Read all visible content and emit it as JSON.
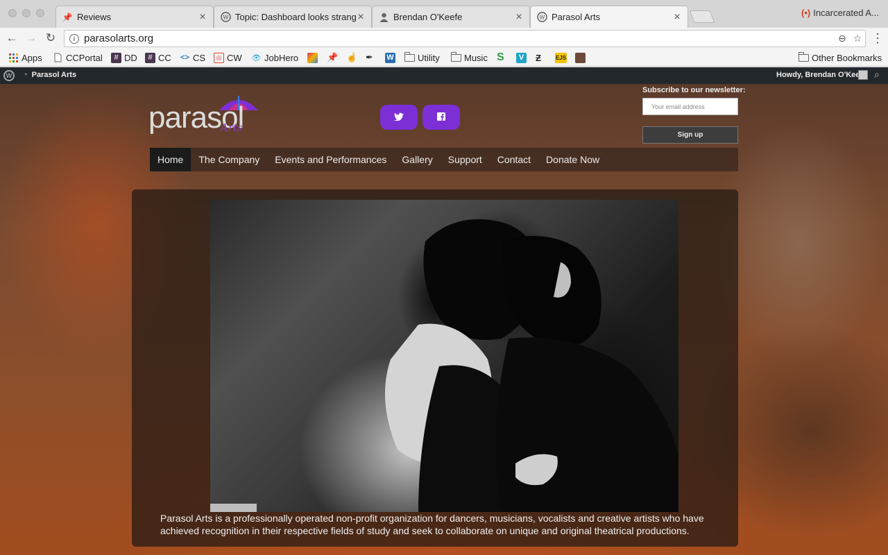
{
  "browser": {
    "tabs": [
      {
        "title": "Reviews",
        "icon": "pin-icon"
      },
      {
        "title": "Topic: Dashboard looks strang",
        "icon": "wordpress-icon"
      },
      {
        "title": "Brendan O'Keefe",
        "icon": "person-icon"
      },
      {
        "title": "Parasol Arts",
        "icon": "wordpress-icon"
      }
    ],
    "tab_right_text": "Incarcerated A...",
    "url": "parasolarts.org",
    "bookmarks": [
      {
        "label": "Apps",
        "icon": "apps-grid-icon"
      },
      {
        "label": "CCPortal",
        "icon": "page-icon"
      },
      {
        "label": "DD",
        "icon": "hash-icon"
      },
      {
        "label": "CC",
        "icon": "hash-icon"
      },
      {
        "label": "CS",
        "icon": "code-icon"
      },
      {
        "label": "CW",
        "icon": "cw-icon"
      },
      {
        "label": "JobHero",
        "icon": "eye-icon"
      },
      {
        "label": "Utility",
        "icon": "folder-icon"
      },
      {
        "label": "Music",
        "icon": "folder-icon"
      },
      {
        "label": "Other Bookmarks",
        "icon": "folder-icon"
      }
    ]
  },
  "adminbar": {
    "site_name": "Parasol Arts",
    "howdy": "Howdy, Brendan O'Keefe"
  },
  "site": {
    "logo_word": "parasol",
    "logo_sub": "Arts",
    "newsletter": {
      "label": "Subscribe to our newsletter:",
      "placeholder": "Your email address",
      "button": "Sign up"
    },
    "nav": [
      "Home",
      "The Company",
      "Events and Performances",
      "Gallery",
      "Support",
      "Contact",
      "Donate Now"
    ],
    "caption": "Parasol Arts is a professionally operated non-profit organization for dancers, musicians, vocalists and creative artists who have achieved recognition in their respective fields of study and seek to collaborate on unique and original theatrical productions."
  },
  "colors": {
    "social_button": "#7d2fd6",
    "logo_accent": "#8a3fbf"
  }
}
